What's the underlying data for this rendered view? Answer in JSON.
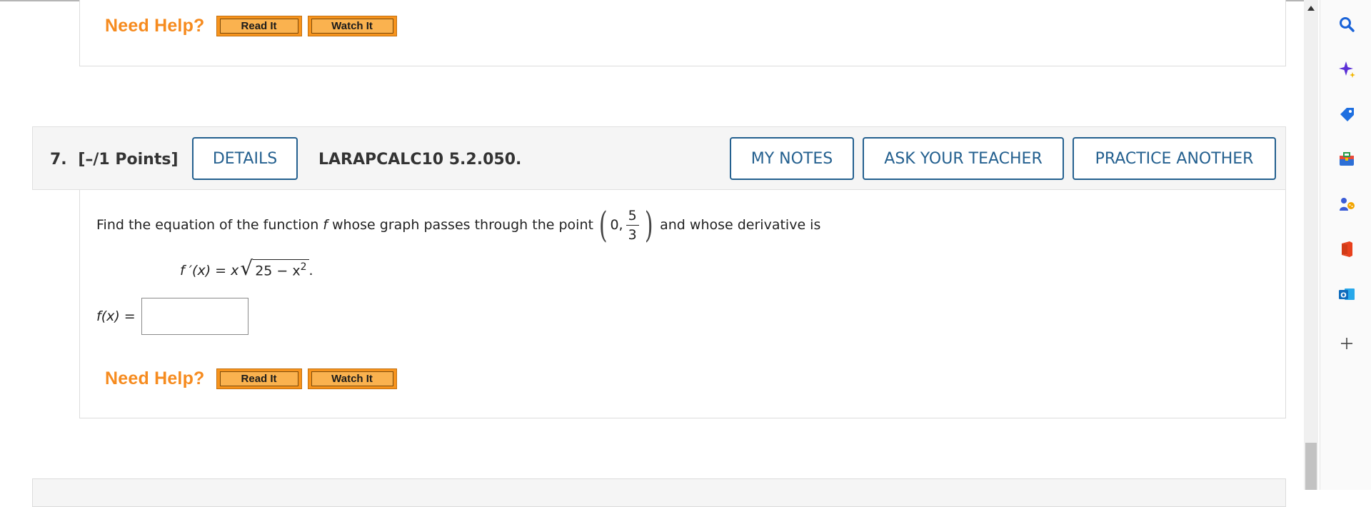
{
  "prev_question": {
    "need_help_label": "Need Help?",
    "read_it_label": "Read It",
    "watch_it_label": "Watch It"
  },
  "question": {
    "number": "7.",
    "points": "[–/1 Points]",
    "details_label": "DETAILS",
    "code": "LARAPCALC10 5.2.050.",
    "my_notes_label": "MY NOTES",
    "ask_teacher_label": "ASK YOUR TEACHER",
    "practice_another_label": "PRACTICE ANOTHER",
    "prompt_before": "Find the equation of the function",
    "prompt_func": "f",
    "prompt_middle": "whose graph passes through the point",
    "point_x": "0,",
    "point_num": "5",
    "point_den": "3",
    "prompt_after": "and whose derivative is",
    "derivative_lhs": "f ′(x) = x",
    "derivative_radicand": "25 − x",
    "derivative_exp": "2",
    "derivative_end": ".",
    "answer_label": "f(x) =",
    "answer_value": "",
    "need_help_label": "Need Help?",
    "read_it_label": "Read It",
    "watch_it_label": "Watch It"
  },
  "sidebar": {
    "icons": [
      "search-icon",
      "copilot-sparkle-icon",
      "shopping-tag-icon",
      "tools-briefcase-icon",
      "games-icon",
      "office-icon",
      "outlook-icon",
      "add-icon"
    ]
  },
  "colors": {
    "accent": "#24608f",
    "need_help": "#f68b1f",
    "help_button": "#f7941d"
  }
}
